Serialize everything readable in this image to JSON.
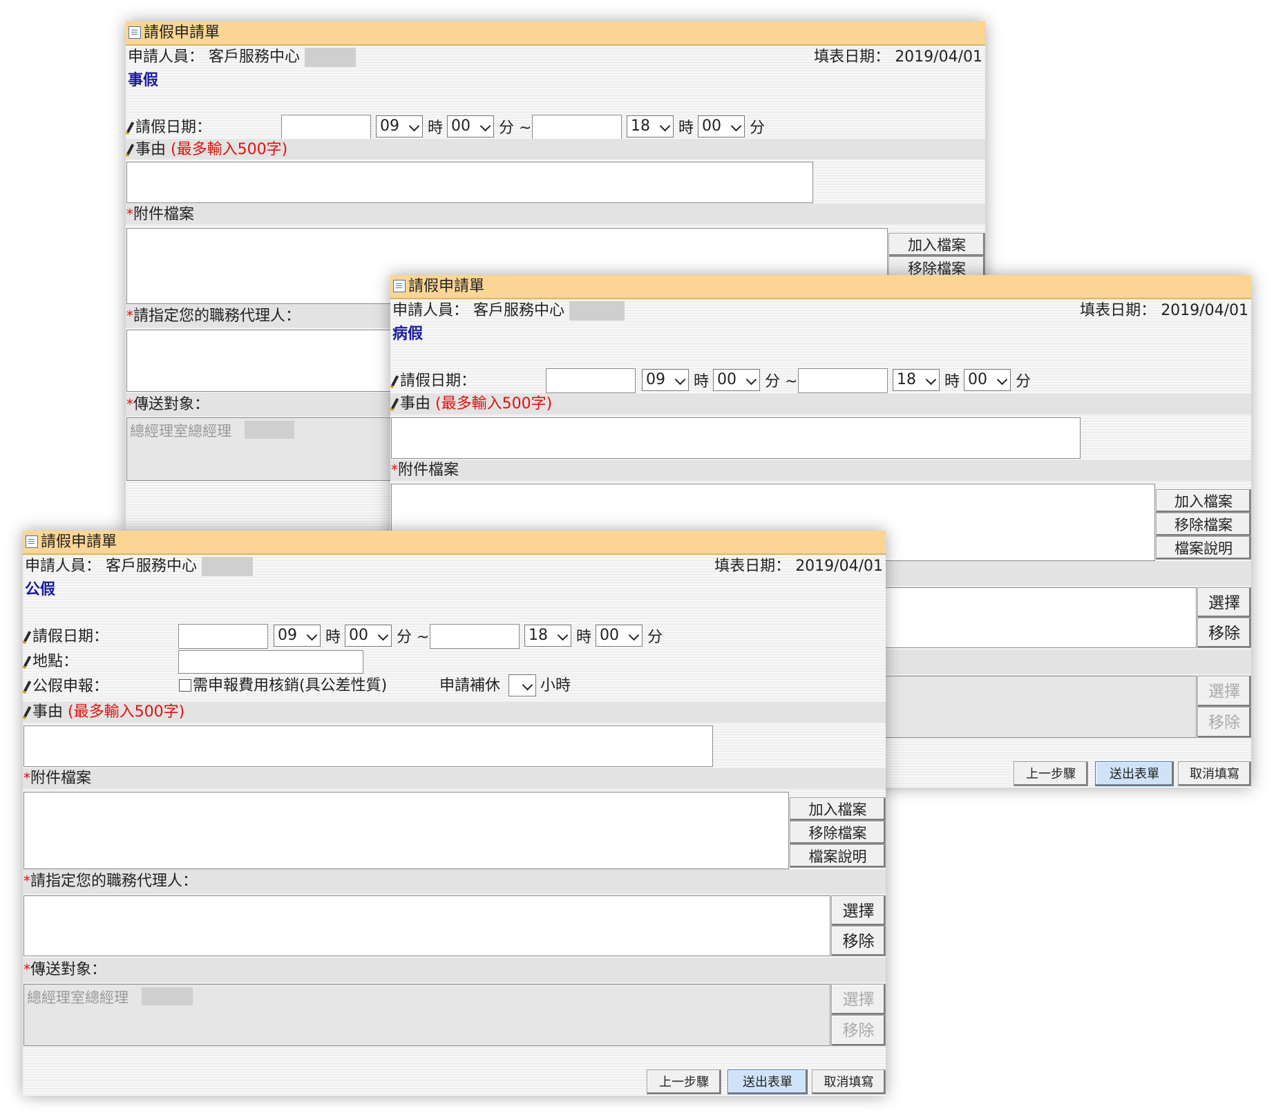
{
  "form": {
    "title": "請假申請單",
    "applicant_label": "申請人員：",
    "applicant_value": "客戶服務中心",
    "date_label": "填表日期：",
    "date_value": "2019/04/01",
    "leave_date_label": "請假日期：",
    "start_hour": "09",
    "start_minute": "00",
    "end_hour": "18",
    "end_minute": "00",
    "hour_unit": "時",
    "minute_unit": "分",
    "minute_tilde": "分 ~",
    "reason_label": "事由",
    "reason_limit": "(最多輸入500字)",
    "attachment_label": "附件檔案",
    "add_file": "加入檔案",
    "remove_file": "移除檔案",
    "file_note": "檔案說明",
    "deputy_label": "請指定您的職務代理人：",
    "select_btn": "選擇",
    "remove_btn": "移除",
    "recipient_label": "傳送對象：",
    "recipient_value": "總經理室總經理",
    "prev_btn": "上一步驟",
    "submit_btn": "送出表單",
    "cancel_btn": "取消填寫",
    "star": "*"
  },
  "windows": {
    "personal": {
      "leave_type": "事假"
    },
    "sick": {
      "leave_type": "病假"
    },
    "official": {
      "leave_type": "公假",
      "location_label": "地點：",
      "report_label": "公假申報：",
      "expense_checkbox": "需申報費用核銷(具公差性質)",
      "comp_leave_label": "申請補休",
      "hours_label": "小時"
    }
  }
}
